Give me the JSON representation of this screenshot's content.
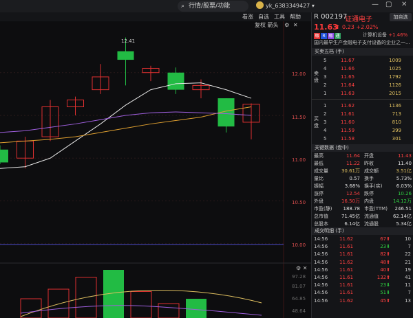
{
  "topbar": {
    "search_placeholder": "行情/股票/功能",
    "user": "yk_6383349427",
    "controls": [
      "min-icon",
      "restore-icon",
      "close-icon"
    ]
  },
  "menubar": {
    "items": [
      "看涨",
      "自选",
      "工具",
      "帮助"
    ],
    "chart_tools": "复权 箭头"
  },
  "chart": {
    "y_ticks_main": [
      "12.00",
      "11.50",
      "11.00",
      "10.50",
      "10.00"
    ],
    "marker_high": "12.41",
    "y_ticks_sub": [
      "97.28",
      "81.07",
      "64.85",
      "48.64"
    ]
  },
  "stock": {
    "code": "R 002197",
    "name": "证通电子",
    "add_label": "加自选",
    "price": "11.63",
    "change": "0.23",
    "change_pct": "+2.02%",
    "tags": [
      {
        "t": "融",
        "c": "#e03030"
      },
      {
        "t": "R",
        "c": "#2255dd"
      },
      {
        "t": "融",
        "c": "#8a4ae0"
      },
      {
        "t": "通",
        "c": "#30a060"
      }
    ],
    "calc_label": "计算机设备",
    "calc_value": "+1.46%",
    "desc": "国内最早生产金融电子支付设备的企业之一..."
  },
  "orderbook": {
    "title": "买卖五档 (手)",
    "sell_label": "卖盘",
    "buy_label": "买盘",
    "sell": [
      {
        "lvl": "5",
        "px": "11.67",
        "vol": "1009"
      },
      {
        "lvl": "4",
        "px": "11.66",
        "vol": "1025"
      },
      {
        "lvl": "3",
        "px": "11.65",
        "vol": "1792"
      },
      {
        "lvl": "2",
        "px": "11.64",
        "vol": "1126"
      },
      {
        "lvl": "1",
        "px": "11.63",
        "vol": "2015"
      }
    ],
    "buy": [
      {
        "lvl": "1",
        "px": "11.62",
        "vol": "1136"
      },
      {
        "lvl": "2",
        "px": "11.61",
        "vol": "713"
      },
      {
        "lvl": "3",
        "px": "11.60",
        "vol": "810"
      },
      {
        "lvl": "4",
        "px": "11.59",
        "vol": "399"
      },
      {
        "lvl": "5",
        "px": "11.58",
        "vol": "301"
      }
    ]
  },
  "stats": {
    "title": "关键数据 (盘中)",
    "rows": [
      {
        "k1": "最高",
        "v1": "11.64",
        "c1": "red",
        "k2": "开盘",
        "v2": "11.43",
        "c2": "red"
      },
      {
        "k1": "最低",
        "v1": "11.22",
        "c1": "red",
        "k2": "昨收",
        "v2": "11.40",
        "c2": "wht"
      },
      {
        "k1": "成交量",
        "v1": "30.61万",
        "c1": "yel",
        "k2": "成交额",
        "v2": "3.51亿",
        "c2": "yel"
      },
      {
        "k1": "量比",
        "v1": "0.57",
        "c1": "wht",
        "k2": "换手",
        "v2": "5.73%",
        "c2": "wht"
      },
      {
        "k1": "振幅",
        "v1": "3.68%",
        "c1": "wht",
        "k2": "换手(实)",
        "v2": "6.03%",
        "c2": "wht"
      },
      {
        "k1": "涨停",
        "v1": "12.54",
        "c1": "red",
        "k2": "跌停",
        "v2": "10.26",
        "c2": "grn"
      },
      {
        "k1": "外盘",
        "v1": "16.50万",
        "c1": "red",
        "k2": "内盘",
        "v2": "14.12万",
        "c2": "grn"
      },
      {
        "k1": "市盈(静)",
        "v1": "188.78",
        "c1": "wht",
        "k2": "市盈(TTM)",
        "v2": "246.51",
        "c2": "wht"
      },
      {
        "k1": "总市值",
        "v1": "71.45亿",
        "c1": "wht",
        "k2": "流通值",
        "v2": "62.14亿",
        "c2": "wht"
      },
      {
        "k1": "总股本",
        "v1": "6.14亿",
        "c1": "wht",
        "k2": "流通股",
        "v2": "5.34亿",
        "c2": "wht"
      }
    ]
  },
  "trades": {
    "title": "成交明细 (手)",
    "rows": [
      {
        "t": "14:56",
        "p": "11.62",
        "v": "67",
        "c": "red",
        "n": "10"
      },
      {
        "t": "14:56",
        "p": "11.61",
        "v": "23",
        "c": "grn",
        "n": "7"
      },
      {
        "t": "14:56",
        "p": "11.61",
        "v": "82",
        "c": "red",
        "n": "22"
      },
      {
        "t": "14:56",
        "p": "11.62",
        "v": "48",
        "c": "red",
        "n": "21"
      },
      {
        "t": "14:56",
        "p": "11.61",
        "v": "40",
        "c": "red",
        "n": "19"
      },
      {
        "t": "14:56",
        "p": "11.61",
        "v": "132",
        "c": "red",
        "n": "41"
      },
      {
        "t": "14:56",
        "p": "11.61",
        "v": "23",
        "c": "grn",
        "n": "11"
      },
      {
        "t": "14:56",
        "p": "11.61",
        "v": "51",
        "c": "grn",
        "n": "7"
      },
      {
        "t": "14:56",
        "p": "11.62",
        "v": "45",
        "c": "red",
        "n": "13"
      }
    ]
  },
  "chart_data": {
    "type": "candlestick",
    "ylim": [
      9.95,
      12.6
    ],
    "candles": [
      {
        "o": 11.1,
        "c": 10.95,
        "h": 11.15,
        "l": 10.93,
        "color": "green"
      },
      {
        "o": 11.0,
        "c": 11.2,
        "h": 11.25,
        "l": 10.88,
        "color": "red"
      },
      {
        "o": 11.25,
        "c": 11.6,
        "h": 11.68,
        "l": 11.2,
        "color": "red"
      },
      {
        "o": 11.6,
        "c": 11.68,
        "h": 11.72,
        "l": 11.5,
        "color": "red"
      },
      {
        "o": 11.8,
        "c": 11.95,
        "h": 12.1,
        "l": 11.75,
        "color": "red"
      },
      {
        "o": 12.25,
        "c": 12.15,
        "h": 12.41,
        "l": 11.85,
        "color": "green"
      },
      {
        "o": 12.0,
        "c": 12.05,
        "h": 12.08,
        "l": 11.9,
        "color": "red"
      },
      {
        "o": 12.0,
        "c": 11.8,
        "h": 12.06,
        "l": 11.75,
        "color": "green"
      },
      {
        "o": 11.8,
        "c": 11.85,
        "h": 11.92,
        "l": 11.7,
        "color": "red"
      },
      {
        "o": 11.7,
        "c": 11.37,
        "h": 11.7,
        "l": 11.3,
        "color": "green"
      },
      {
        "o": 11.42,
        "c": 11.63,
        "h": 11.64,
        "l": 11.22,
        "color": "red"
      }
    ],
    "ma_white": [
      10.88,
      10.9,
      11.0,
      11.2,
      11.4,
      11.62,
      11.8,
      11.87,
      11.88,
      11.8,
      11.7
    ],
    "ma_yellow": [
      11.18,
      11.2,
      11.22,
      11.25,
      11.3,
      11.35,
      11.4,
      11.44,
      11.48,
      11.55,
      11.6
    ],
    "ma_purple": [
      11.3,
      11.32,
      11.36,
      11.4,
      11.45,
      11.5,
      11.53,
      11.54,
      11.53,
      11.52,
      11.5
    ],
    "volume": [
      {
        "v": 40,
        "color": "red"
      },
      {
        "v": 60,
        "color": "red"
      },
      {
        "v": 85,
        "color": "red"
      },
      {
        "v": 100,
        "color": "green"
      },
      {
        "v": 55,
        "color": "red"
      },
      {
        "v": 30,
        "color": "red"
      },
      {
        "v": 40,
        "color": "green"
      }
    ]
  }
}
